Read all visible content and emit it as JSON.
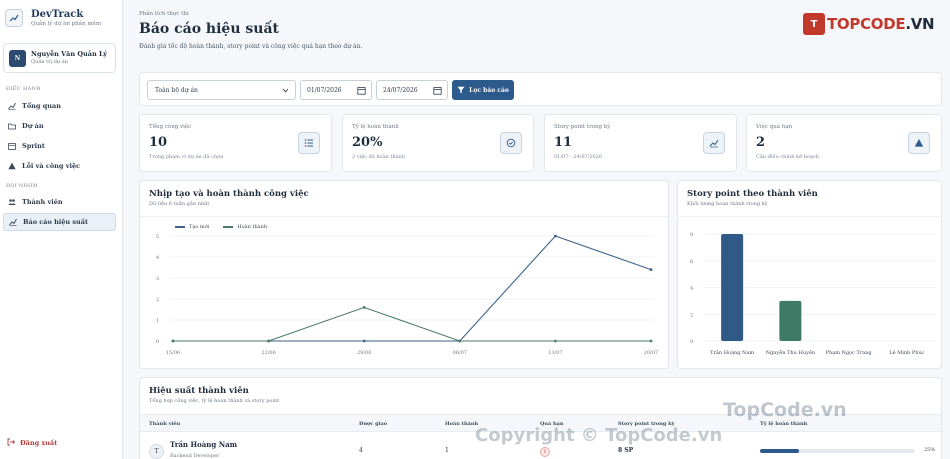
{
  "brand": {
    "title": "DevTrack",
    "subtitle": "Quản lý dự án phần mềm"
  },
  "user": {
    "initial": "N",
    "name": "Nguyễn Văn Quản Lý",
    "role": "Quản trị dự án"
  },
  "sidebar": {
    "sections": [
      {
        "label": "ĐIỀU HÀNH"
      },
      {
        "label": "ĐỘI NHÓM"
      }
    ],
    "items": [
      {
        "label": "Tổng quan",
        "icon": "chart-line-icon"
      },
      {
        "label": "Dự án",
        "icon": "folder-icon"
      },
      {
        "label": "Sprint",
        "icon": "calendar-icon"
      },
      {
        "label": "Lỗi và công việc",
        "icon": "warning-icon"
      },
      {
        "label": "Thành viên",
        "icon": "users-icon"
      },
      {
        "label": "Báo cáo hiệu suất",
        "icon": "chart-line-icon",
        "active": true
      }
    ],
    "logout": "Đăng xuất"
  },
  "header": {
    "eyebrow": "Phân tích thực thi",
    "title": "Báo cáo hiệu suất",
    "description": "Đánh giá tốc độ hoàn thành, story point và công việc quá hạn theo dự án."
  },
  "logo": {
    "mark": "T",
    "text_a": "TOPCODE",
    "text_b": ".VN"
  },
  "filter": {
    "project": "Toàn bộ dự án",
    "date_from": "01/07/2026",
    "date_to": "24/07/2026",
    "button": "Lọc báo cáo"
  },
  "stats": [
    {
      "label": "Tổng công việc",
      "value": "10",
      "sub": "Trong phạm vi dự án đã chọn",
      "icon": "list-icon"
    },
    {
      "label": "Tỷ lệ hoàn thành",
      "value": "20%",
      "sub": "2 việc đã hoàn thành",
      "icon": "check-circle-icon"
    },
    {
      "label": "Story point trong kỳ",
      "value": "11",
      "sub": "01/07 - 24/07/2026",
      "icon": "chart-line-icon"
    },
    {
      "label": "Việc quá hạn",
      "value": "2",
      "sub": "Cần điều chỉnh kế hoạch",
      "icon": "warning-icon"
    }
  ],
  "line_card": {
    "title": "Nhịp tạo và hoàn thành công việc",
    "subtitle": "Dữ liệu 6 tuần gần nhất"
  },
  "bar_card": {
    "title": "Story point theo thành viên",
    "subtitle": "Khối lượng hoàn thành trong kỳ"
  },
  "table": {
    "title": "Hiệu suất thành viên",
    "subtitle": "Tổng hợp công việc, tỷ lệ hoàn thành và story point",
    "columns": [
      "Thành viên",
      "Được giao",
      "Hoàn thành",
      "Quá hạn",
      "Story point trong kỳ",
      "Tỷ lệ hoàn thành"
    ],
    "rows": [
      {
        "initial": "T",
        "name": "Trần Hoàng Nam",
        "role": "Backend Developer",
        "assigned": "4",
        "done": "1",
        "overdue": "1",
        "sp": "8 SP",
        "rate_label": "25%",
        "rate": 0.25
      }
    ]
  },
  "watermarks": {
    "a": "TopCode.vn",
    "b": "Copyright © TopCode.vn"
  },
  "chart_data": [
    {
      "type": "line",
      "x": [
        "15/06",
        "22/06",
        "29/06",
        "06/07",
        "13/07",
        "20/07"
      ],
      "series": [
        {
          "name": "Tạo mới",
          "values": [
            0,
            0,
            0,
            0,
            5,
            3.4
          ],
          "color": "#3e6289"
        },
        {
          "name": "Hoàn thành",
          "values": [
            0,
            0,
            1.6,
            0,
            0,
            0
          ],
          "color": "#4a7a68"
        }
      ],
      "ylim": [
        0,
        5
      ],
      "yticks": [
        0,
        1,
        2,
        3,
        4,
        5
      ],
      "legend": "top-left",
      "grid": true
    },
    {
      "type": "bar",
      "categories": [
        "Trần Hoàng Nam",
        "Nguyễn Thu Huyền",
        "Phạm Ngọc Trang",
        "Lê Minh Phúc"
      ],
      "values": [
        8,
        3,
        0,
        0
      ],
      "colors": [
        "#2f5a87",
        "#3f7a66",
        "#2f5a87",
        "#2f5a87"
      ],
      "ylim": [
        0,
        8
      ],
      "yticks": [
        0,
        2,
        4,
        6,
        8
      ],
      "grid": true
    }
  ]
}
